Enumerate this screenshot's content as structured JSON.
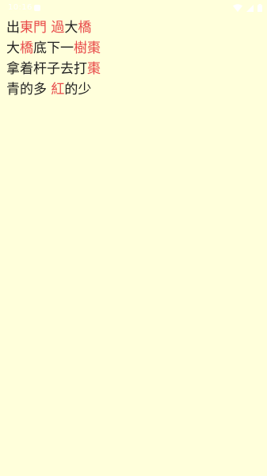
{
  "status_bar": {
    "time": "10:16",
    "colors": {
      "foreground": "#ffffff"
    }
  },
  "poem": {
    "colors": {
      "text": "#222222",
      "highlight": "#e84a4a",
      "background": "#ffffdb"
    },
    "lines": [
      {
        "segments": [
          {
            "text": "出",
            "highlight": false
          },
          {
            "text": "東門",
            "highlight": true
          },
          {
            "text": " ",
            "highlight": false
          },
          {
            "text": "過",
            "highlight": true
          },
          {
            "text": "大",
            "highlight": false
          },
          {
            "text": "橋",
            "highlight": true
          }
        ]
      },
      {
        "segments": [
          {
            "text": "大",
            "highlight": false
          },
          {
            "text": "橋",
            "highlight": true
          },
          {
            "text": "底下一",
            "highlight": false
          },
          {
            "text": "樹棗",
            "highlight": true
          }
        ]
      },
      {
        "segments": [
          {
            "text": "拿着杆子去打",
            "highlight": false
          },
          {
            "text": "棗",
            "highlight": true
          }
        ]
      },
      {
        "segments": [
          {
            "text": "青的多 ",
            "highlight": false
          },
          {
            "text": "紅",
            "highlight": true
          },
          {
            "text": "的少",
            "highlight": false
          }
        ]
      }
    ]
  }
}
